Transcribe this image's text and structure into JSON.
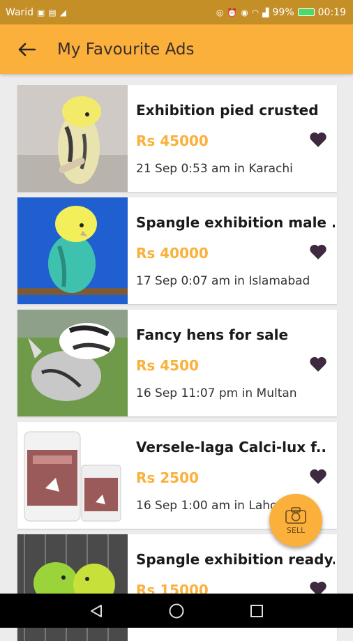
{
  "status_bar": {
    "carrier": "Warid",
    "battery": "99%",
    "time": "00:19"
  },
  "app_bar": {
    "title": "My Favourite Ads",
    "back_icon": "arrow-left-icon"
  },
  "ads": [
    {
      "title": "Exhibition pied crusted",
      "price": "Rs 45000",
      "meta": "21 Sep 0:53 am in Karachi",
      "image": "budgie-pied-crested-photo"
    },
    {
      "title": "Spangle exhibition male ..",
      "price": "Rs 40000",
      "meta": "17 Sep 0:07 am in Islamabad",
      "image": "budgie-spangle-blue-photo"
    },
    {
      "title": "Fancy hens for sale",
      "price": "Rs 4500",
      "meta": "16 Sep 11:07 pm in Multan",
      "image": "polish-hen-photo"
    },
    {
      "title": "Versele-laga Calci-lux f..",
      "price": "Rs 2500",
      "meta": "16 Sep 1:00 am in Lahore",
      "image": "calci-lux-product-photo"
    },
    {
      "title": "Spangle exhibition ready..",
      "price": "Rs 15000",
      "meta": "",
      "image": "green-budgies-photo"
    }
  ],
  "sell_button": {
    "label": "SELL",
    "icon": "camera-icon"
  },
  "colors": {
    "accent": "#fbb03b",
    "status_bar": "#c48f27",
    "heart": "#3d2a3f"
  },
  "nav": {
    "back": "nav-back-icon",
    "home": "nav-home-icon",
    "recents": "nav-recents-icon"
  }
}
